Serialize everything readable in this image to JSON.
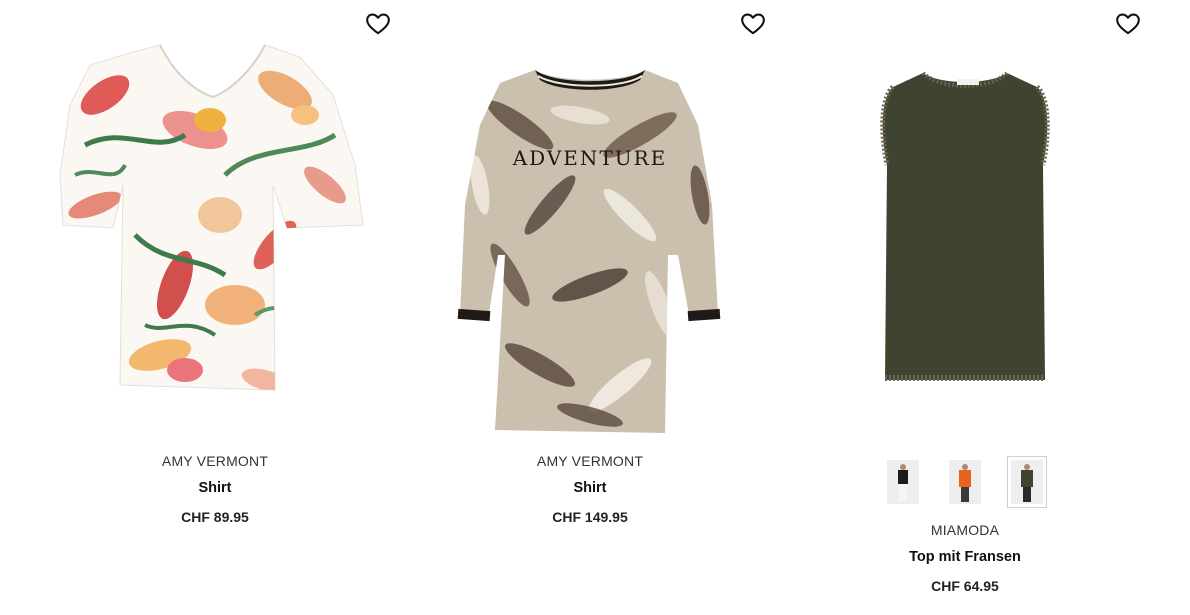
{
  "products": [
    {
      "brand": "AMY VERMONT",
      "name": "Shirt",
      "price": "CHF 89.95",
      "image_desc": "white-floral-v-neck-shirt",
      "wishlist_icon": "heart-outline-icon"
    },
    {
      "brand": "AMY VERMONT",
      "name": "Shirt",
      "price": "CHF 149.95",
      "image_desc": "beige-leaf-print-tunic",
      "wishlist_icon": "heart-outline-icon"
    },
    {
      "brand": "MIAMODA",
      "name": "Top mit Fransen",
      "price": "CHF 64.95",
      "image_desc": "olive-sleeveless-top-with-fringes",
      "wishlist_icon": "heart-outline-icon",
      "color_swatches": [
        {
          "color": "black",
          "hex": "#1b1b1b",
          "selected": false
        },
        {
          "color": "orange",
          "hex": "#e8631f",
          "selected": false
        },
        {
          "color": "olive",
          "hex": "#3f4430",
          "selected": true
        }
      ]
    }
  ],
  "colors": {
    "text": "#222222",
    "olive": "#3f4430",
    "swatch_border": "#cfcfcf"
  }
}
